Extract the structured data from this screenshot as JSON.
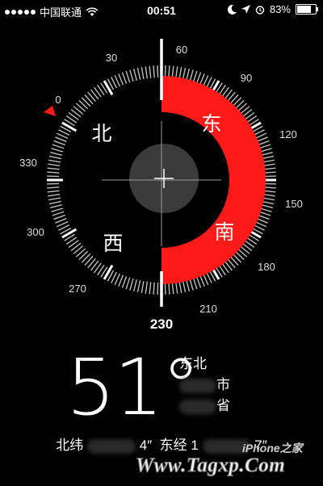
{
  "status_bar": {
    "carrier": "中国联通",
    "time": "00:51",
    "battery_percent": "83%",
    "battery_level": 0.83,
    "icons": [
      "signal-dots-icon",
      "wifi-icon",
      "moon-icon",
      "location-arrow-icon",
      "alarm-icon",
      "battery-icon"
    ]
  },
  "compass": {
    "heading_degrees": 51,
    "heading_readout": "230",
    "degree_labels": [
      "0",
      "30",
      "60",
      "90",
      "120",
      "150",
      "180",
      "210",
      "270",
      "300",
      "330"
    ],
    "cardinal": {
      "north": "北",
      "east": "东",
      "south": "南",
      "west": "西"
    },
    "arc_color": "#ff1a1a"
  },
  "readout": {
    "degrees": "51°",
    "direction": "东北",
    "city_suffix": "市",
    "province_suffix": "省"
  },
  "coordinates": {
    "lat_label": "北纬",
    "lat_tail": "4″",
    "lon_label": "东经",
    "lon_head": "1",
    "lon_tail": "7″"
  },
  "watermark": {
    "text": "Www.Tagxp.Com",
    "badge": "iPhone之家"
  }
}
